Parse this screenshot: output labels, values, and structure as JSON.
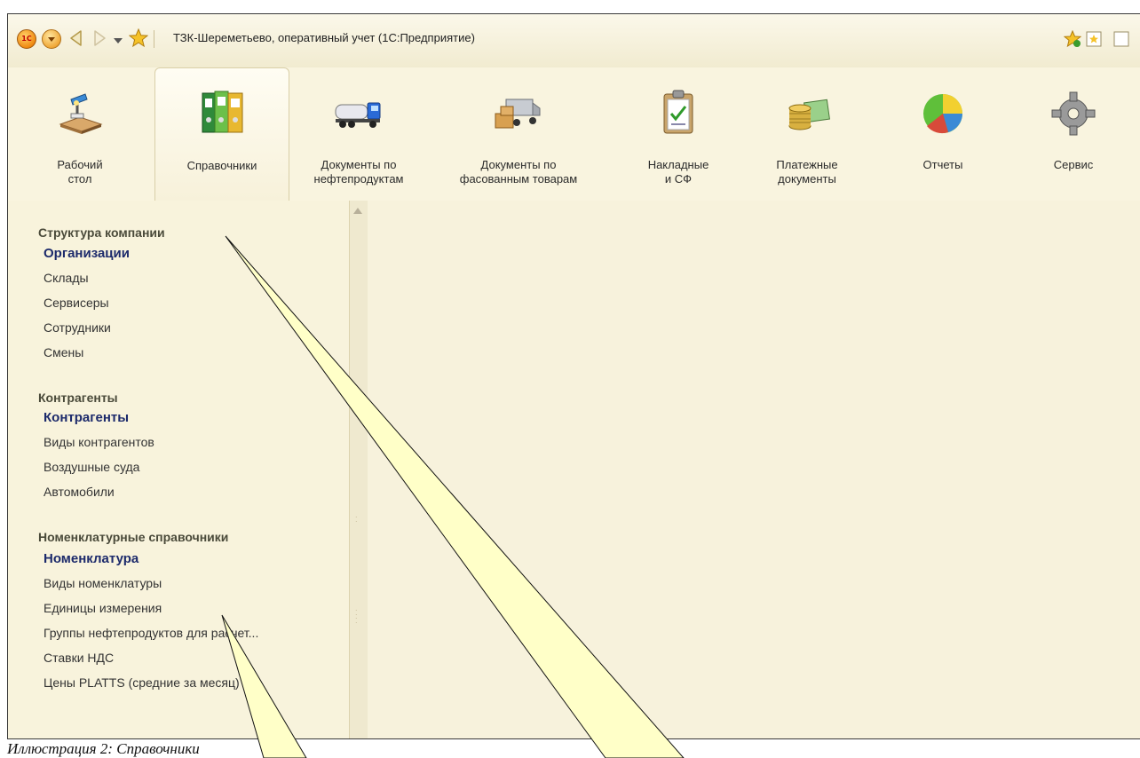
{
  "window": {
    "title": "ТЗК-Шереметьево, оперативный учет  (1С:Предприятие)",
    "logo_text": "1С"
  },
  "sections": [
    {
      "label": "Рабочий\nстол",
      "icon": "desk-lamp-icon"
    },
    {
      "label": "Справочники",
      "icon": "binders-icon",
      "active": true
    },
    {
      "label": "Документы по\nнефтепродуктам",
      "icon": "fuel-truck-icon"
    },
    {
      "label": "Документы по\nфасованным товарам",
      "icon": "delivery-van-icon"
    },
    {
      "label": "Накладные\nи СФ",
      "icon": "clipboard-icon"
    },
    {
      "label": "Платежные\nдокументы",
      "icon": "money-coins-icon"
    },
    {
      "label": "Отчеты",
      "icon": "pie-chart-icon"
    },
    {
      "label": "Сервис",
      "icon": "gear-icon"
    }
  ],
  "nav": {
    "groups": [
      {
        "title": "Структура компании",
        "items": [
          "Организации",
          "Склады",
          "Сервисеры",
          "Сотрудники",
          "Смены"
        ]
      },
      {
        "title": "Контрагенты",
        "items": [
          "Контрагенты",
          "Виды контрагентов",
          "Воздушные суда",
          "Автомобили"
        ]
      },
      {
        "title": "Номенклатурные справочники",
        "items": [
          "Номенклатура",
          "Виды номенклатуры",
          "Единицы измерения",
          "Группы нефтепродуктов для расчет...",
          "Ставки НДС",
          "Цены PLATTS (средние за месяц)"
        ]
      }
    ]
  },
  "caption": "Иллюстрация 2: Справочники",
  "colors": {
    "callout_fill": "#ffffc8",
    "bold_link": "#1c2a6b"
  }
}
